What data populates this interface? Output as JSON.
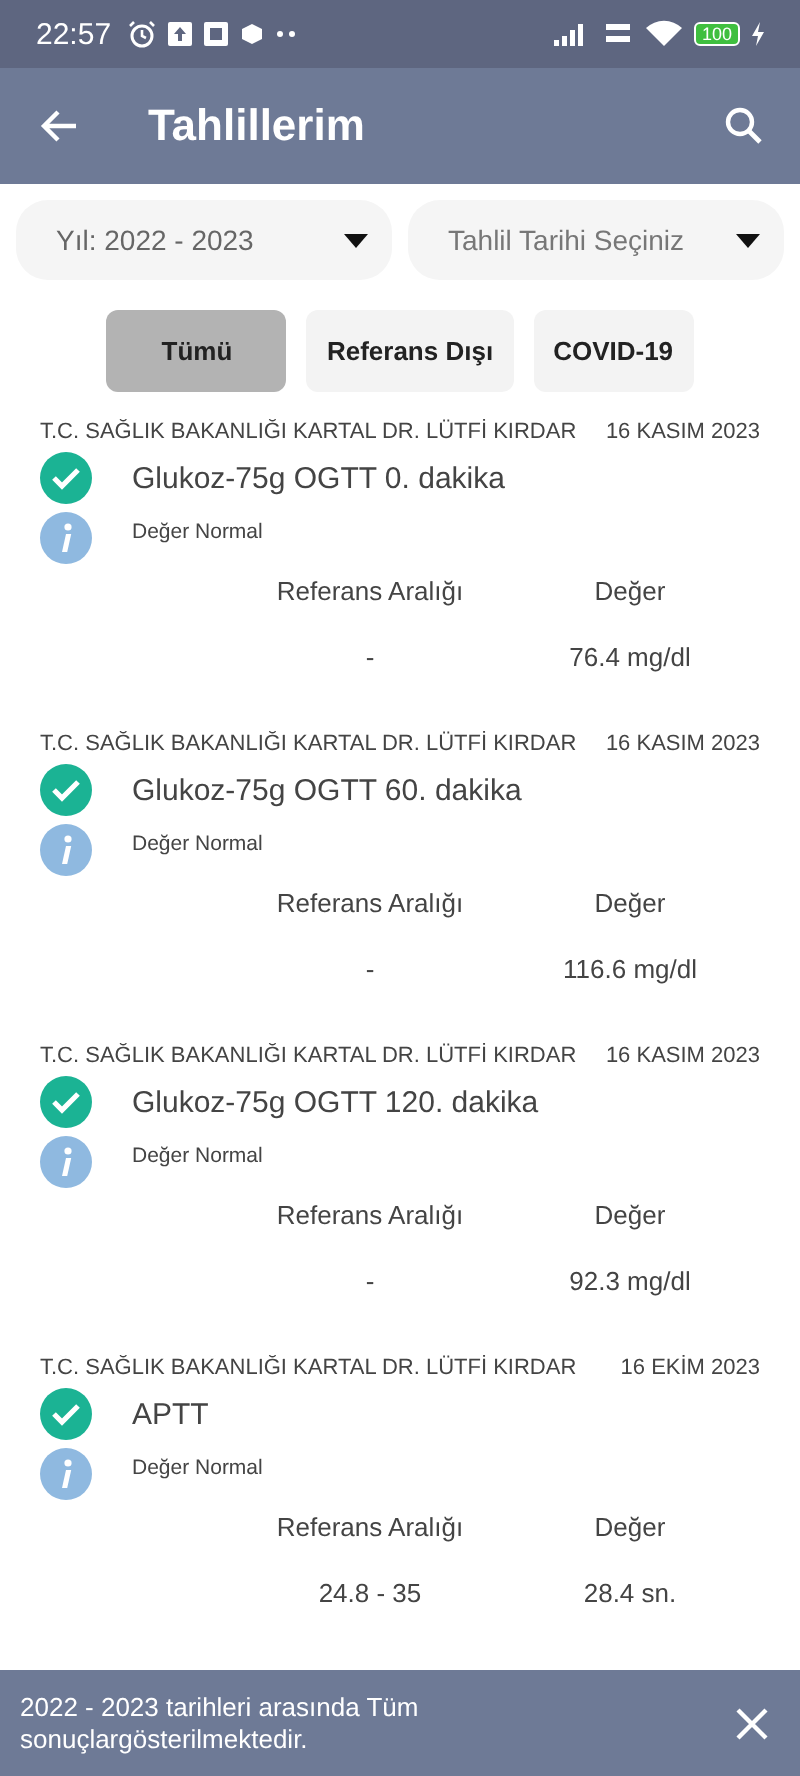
{
  "status_bar": {
    "time": "22:57",
    "battery": "100"
  },
  "app_bar": {
    "title": "Tahlillerim"
  },
  "filters": [
    {
      "label": "Yıl: 2022 - 2023",
      "kind": "value"
    },
    {
      "label": "Tahlil Tarihi Seçiniz",
      "kind": "placeholder"
    }
  ],
  "tabs": [
    {
      "label": "Tümü",
      "selected": true
    },
    {
      "label": "Referans Dışı",
      "selected": false
    },
    {
      "label": "COVID-19",
      "selected": false
    }
  ],
  "results": [
    {
      "hospital": "T.C. SAĞLIK BAKANLIĞI KARTAL DR. LÜTFİ KIRDAR",
      "date": "16 KASIM 2023",
      "name": "Glukoz-75g OGTT 0. dakika",
      "status": "Değer Normal",
      "normal": true,
      "range_label": "Referans Aralığı",
      "value_label": "Değer",
      "range": "-",
      "value": "76.4 mg/dl"
    },
    {
      "hospital": "T.C. SAĞLIK BAKANLIĞI KARTAL DR. LÜTFİ KIRDAR",
      "date": "16 KASIM 2023",
      "name": "Glukoz-75g OGTT 60. dakika",
      "status": "Değer Normal",
      "normal": true,
      "range_label": "Referans Aralığı",
      "value_label": "Değer",
      "range": "-",
      "value": "116.6 mg/dl"
    },
    {
      "hospital": "T.C. SAĞLIK BAKANLIĞI KARTAL DR. LÜTFİ KIRDAR",
      "date": "16 KASIM 2023",
      "name": "Glukoz-75g OGTT 120. dakika",
      "status": "Değer Normal",
      "normal": true,
      "range_label": "Referans Aralığı",
      "value_label": "Değer",
      "range": "-",
      "value": "92.3 mg/dl"
    },
    {
      "hospital": "T.C. SAĞLIK BAKANLIĞI KARTAL DR. LÜTFİ KIRDAR",
      "date": "16 EKİM 2023",
      "name": "APTT",
      "status": "Değer Normal",
      "normal": true,
      "range_label": "Referans Aralığı",
      "value_label": "Değer",
      "range": "24.8 - 35",
      "value": "28.4 sn."
    }
  ],
  "snackbar": {
    "message": "2022 - 2023 tarihleri arasında Tüm sonuçlargösterilmektedir."
  }
}
